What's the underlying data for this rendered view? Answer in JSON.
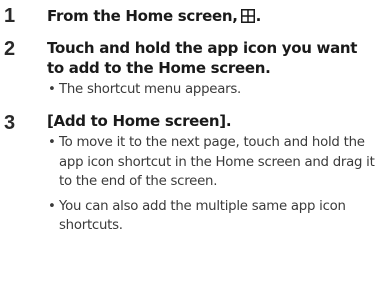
{
  "steps": [
    {
      "number": "1",
      "title": "From the Home screen,",
      "title_suffix": ".",
      "icon": "apps-grid-icon",
      "bullets": []
    },
    {
      "number": "2",
      "title": "Touch and hold the app icon you want to add to the Home screen.",
      "bullets": [
        "The shortcut menu appears."
      ]
    },
    {
      "number": "3",
      "title": "[Add to Home screen].",
      "bullets": [
        "To move it to the next page, touch and hold the app icon shortcut in the Home screen and drag it to the end of the screen.",
        "You can also add the multiple same app icon shortcuts."
      ]
    }
  ]
}
